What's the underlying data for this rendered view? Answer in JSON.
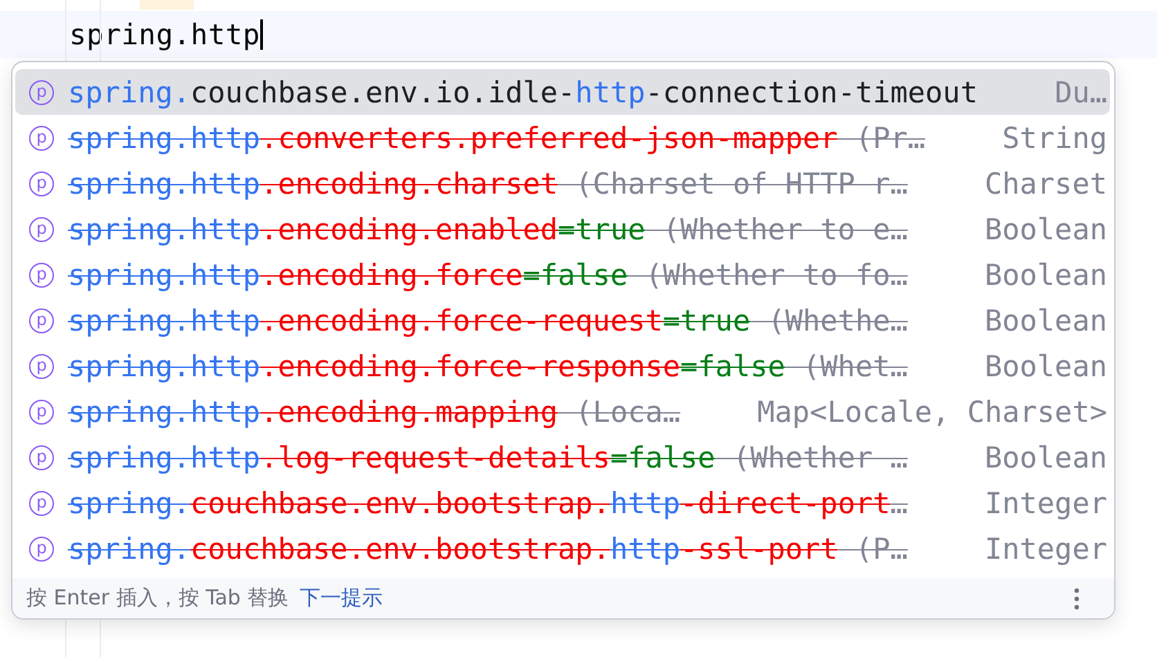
{
  "editor": {
    "line": "spring.http"
  },
  "completion": {
    "items": [
      {
        "badge": "p",
        "selected": true,
        "deprecated": false,
        "segments": [
          {
            "kind": "match",
            "text": "spring."
          },
          {
            "kind": "name",
            "text": "couchbase.env.io.idle-"
          },
          {
            "kind": "match",
            "text": "http"
          },
          {
            "kind": "name",
            "text": "-connection-timeout"
          }
        ],
        "type": "Du…"
      },
      {
        "badge": "p",
        "selected": false,
        "deprecated": true,
        "segments": [
          {
            "kind": "match",
            "text": "spring.http"
          },
          {
            "kind": "name",
            "text": ".converters.preferred-json-mapper"
          },
          {
            "kind": "hint",
            "text": " (Pr…"
          }
        ],
        "type": "String"
      },
      {
        "badge": "p",
        "selected": false,
        "deprecated": true,
        "segments": [
          {
            "kind": "match",
            "text": "spring.http"
          },
          {
            "kind": "name",
            "text": ".encoding.charset"
          },
          {
            "kind": "hint",
            "text": " (Charset of HTTP r…"
          }
        ],
        "type": "Charset"
      },
      {
        "badge": "p",
        "selected": false,
        "deprecated": true,
        "segments": [
          {
            "kind": "match",
            "text": "spring.http"
          },
          {
            "kind": "name",
            "text": ".encoding.enabled"
          },
          {
            "kind": "value",
            "text": "=true"
          },
          {
            "kind": "hint",
            "text": " (Whether to e…"
          }
        ],
        "type": "Boolean"
      },
      {
        "badge": "p",
        "selected": false,
        "deprecated": true,
        "segments": [
          {
            "kind": "match",
            "text": "spring.http"
          },
          {
            "kind": "name",
            "text": ".encoding.force"
          },
          {
            "kind": "value",
            "text": "=false"
          },
          {
            "kind": "hint",
            "text": " (Whether to fo…"
          }
        ],
        "type": "Boolean"
      },
      {
        "badge": "p",
        "selected": false,
        "deprecated": true,
        "segments": [
          {
            "kind": "match",
            "text": "spring.http"
          },
          {
            "kind": "name",
            "text": ".encoding.force-request"
          },
          {
            "kind": "value",
            "text": "=true"
          },
          {
            "kind": "hint",
            "text": " (Whethe…"
          }
        ],
        "type": "Boolean"
      },
      {
        "badge": "p",
        "selected": false,
        "deprecated": true,
        "segments": [
          {
            "kind": "match",
            "text": "spring.http"
          },
          {
            "kind": "name",
            "text": ".encoding.force-response"
          },
          {
            "kind": "value",
            "text": "=false"
          },
          {
            "kind": "hint",
            "text": " (Whet…"
          }
        ],
        "type": "Boolean"
      },
      {
        "badge": "p",
        "selected": false,
        "deprecated": true,
        "segments": [
          {
            "kind": "match",
            "text": "spring.http"
          },
          {
            "kind": "name",
            "text": ".encoding.mapping"
          },
          {
            "kind": "hint",
            "text": " (Loca…"
          }
        ],
        "type": "Map<Locale, Charset>"
      },
      {
        "badge": "p",
        "selected": false,
        "deprecated": true,
        "segments": [
          {
            "kind": "match",
            "text": "spring.http"
          },
          {
            "kind": "name",
            "text": ".log-request-details"
          },
          {
            "kind": "value",
            "text": "=false"
          },
          {
            "kind": "hint",
            "text": " (Whether …"
          }
        ],
        "type": "Boolean"
      },
      {
        "badge": "p",
        "selected": false,
        "deprecated": true,
        "segments": [
          {
            "kind": "match",
            "text": "spring."
          },
          {
            "kind": "name",
            "text": "couchbase.env.bootstrap."
          },
          {
            "kind": "match",
            "text": "http"
          },
          {
            "kind": "name",
            "text": "-direct-port"
          },
          {
            "kind": "hint",
            "text": "…"
          }
        ],
        "type": "Integer"
      },
      {
        "badge": "p",
        "selected": false,
        "deprecated": true,
        "segments": [
          {
            "kind": "match",
            "text": "spring."
          },
          {
            "kind": "name",
            "text": "couchbase.env.bootstrap."
          },
          {
            "kind": "match",
            "text": "http"
          },
          {
            "kind": "name",
            "text": "-ssl-port"
          },
          {
            "kind": "hint",
            "text": " (P…"
          }
        ],
        "type": "Integer"
      }
    ],
    "footer": {
      "hint": "按 Enter 插入，按 Tab 替换",
      "link": "下一提示"
    }
  }
}
